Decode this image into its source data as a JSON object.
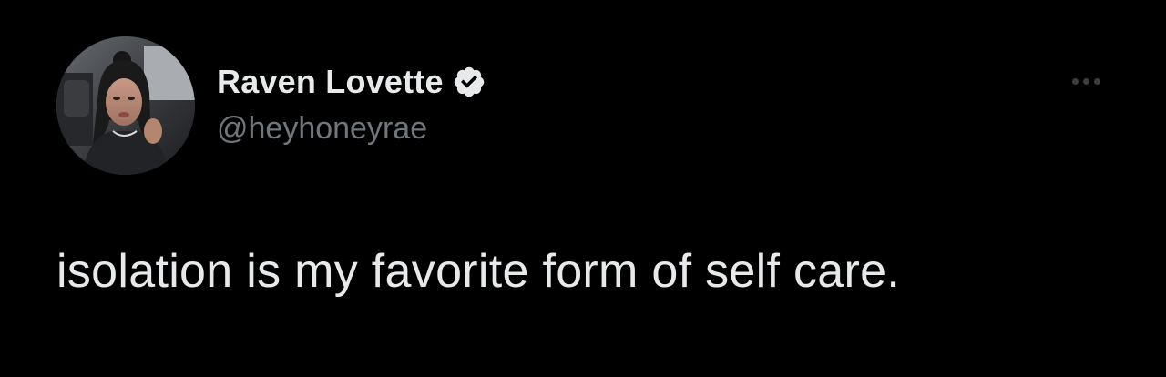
{
  "tweet": {
    "author": {
      "display_name": "Raven Lovette",
      "handle": "@heyhoneyrae",
      "verified": true,
      "avatar_icon": "profile-photo"
    },
    "text": "isolation is my favorite form of self care.",
    "more_icon": "more-horizontal-icon"
  },
  "colors": {
    "background": "#000000",
    "primary_text": "#e7e9ea",
    "secondary_text": "#71767b",
    "verified_badge": "#e7e9ea",
    "more_dots": "#3a3d41"
  }
}
